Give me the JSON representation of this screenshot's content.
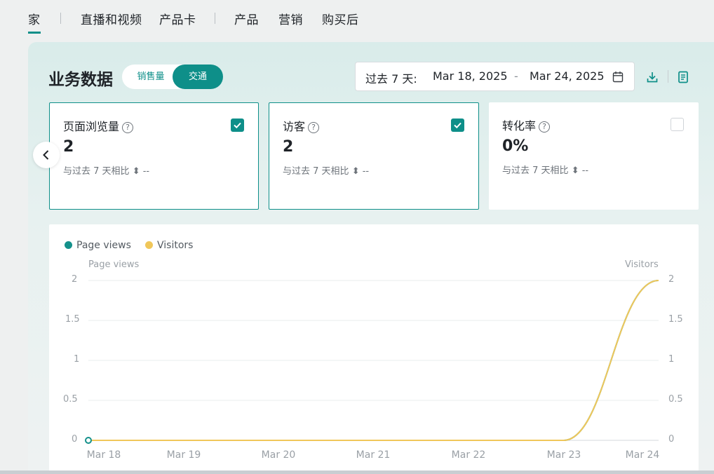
{
  "nav": {
    "items": [
      "家",
      "直播和视频",
      "产品卡",
      "产品",
      "营销",
      "购买后"
    ]
  },
  "section": {
    "title": "业务数据",
    "toggle_options": [
      "销售量",
      "交通"
    ],
    "toggle_selected": "交通"
  },
  "date_range": {
    "prefix": "过去 7 天:",
    "start": "Mar 18, 2025",
    "separator": "-",
    "end": "Mar 24, 2025"
  },
  "icons": {
    "calendar": "calendar-icon",
    "download": "download-icon",
    "report": "report-icon",
    "previous": "chevron-left-icon"
  },
  "metrics": [
    {
      "title": "页面浏览量",
      "value": "2",
      "compare": "与过去 7 天相比",
      "delta": "--",
      "checked": true
    },
    {
      "title": "访客",
      "value": "2",
      "compare": "与过去 7 天相比",
      "delta": "--",
      "checked": true
    },
    {
      "title": "转化率",
      "value": "0%",
      "compare": "与过去 7 天相比",
      "delta": "--",
      "checked": false
    }
  ],
  "colors": {
    "accent": "#0e8f89",
    "page_views": "#15918b",
    "visitors": "#f0c75a"
  },
  "chart_data": {
    "type": "line",
    "x": [
      "Mar 18",
      "Mar 19",
      "Mar 20",
      "Mar 21",
      "Mar 22",
      "Mar 23",
      "Mar 24"
    ],
    "series": [
      {
        "name": "Page views",
        "values": [
          0,
          0,
          0,
          0,
          0,
          0,
          2
        ]
      },
      {
        "name": "Visitors",
        "values": [
          0,
          0,
          0,
          0,
          0,
          0,
          2
        ]
      }
    ],
    "ylabel_left": "Page views",
    "ylabel_right": "Visitors",
    "yticks": [
      "2",
      "1.5",
      "1",
      "0.5",
      "0"
    ],
    "ylim": [
      0,
      2
    ],
    "grid": true,
    "legend": "top-left"
  }
}
